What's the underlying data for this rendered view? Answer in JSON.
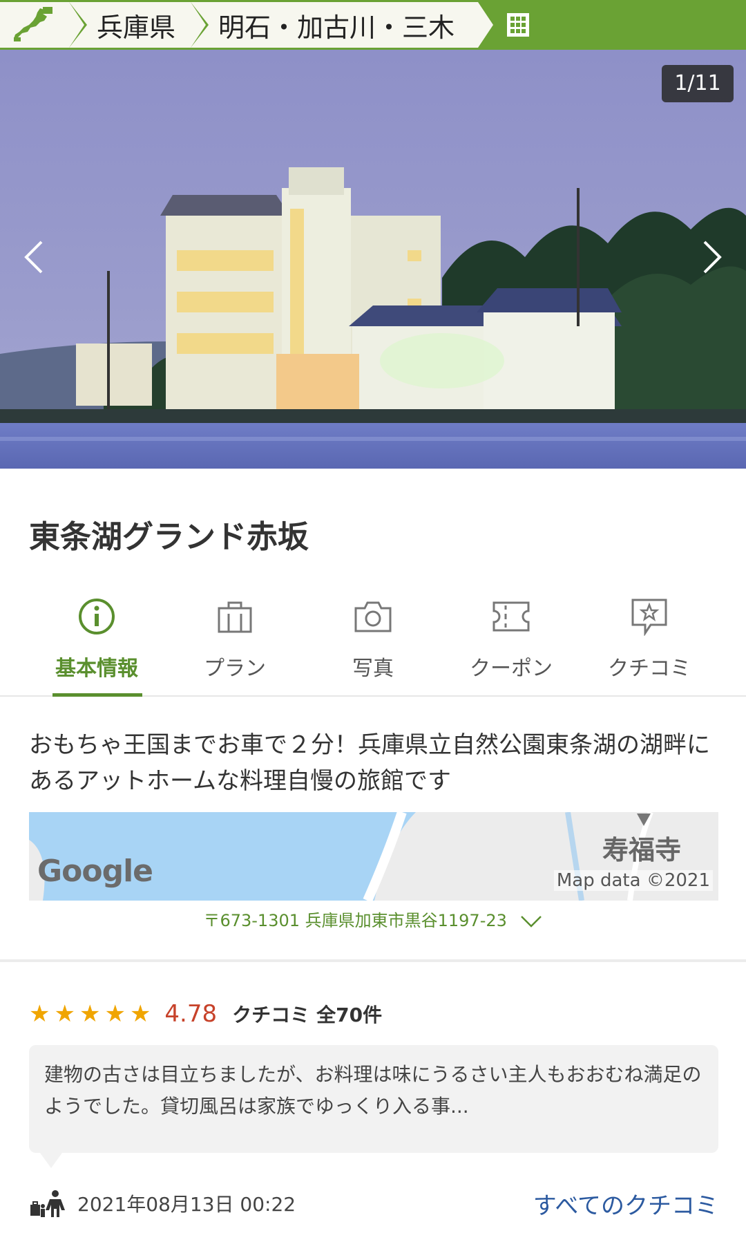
{
  "breadcrumb": {
    "items": [
      "兵庫県",
      "明石・加古川・三木"
    ]
  },
  "photo": {
    "counter": "1/11"
  },
  "hotel": {
    "name": "東条湖グランド赤坂"
  },
  "tabs": [
    {
      "label": "基本情報",
      "icon": "info-icon",
      "active": true
    },
    {
      "label": "プラン",
      "icon": "bag-icon",
      "active": false
    },
    {
      "label": "写真",
      "icon": "camera-icon",
      "active": false
    },
    {
      "label": "クーポン",
      "icon": "ticket-icon",
      "active": false
    },
    {
      "label": "クチコミ",
      "icon": "review-star-icon",
      "active": false
    }
  ],
  "description": "おもちゃ王国までお車で２分！兵庫県立自然公園東条湖の湖畔にあるアットホームな料理自慢の旅館です",
  "map": {
    "place_label": "寿福寺",
    "logo": "Google",
    "attribution": "Map data ©2021"
  },
  "address": "〒673-1301 兵庫県加東市黒谷1197-23",
  "reviews": {
    "stars": 5,
    "score": "4.78",
    "label": "クチコミ",
    "count": "全70件",
    "excerpt": "建物の古さは目立ちましたが、お料理は味にうるさい主人もおおむね満足のようでした。貸切風呂は家族でゆっくり入る事...",
    "date": "2021年08月13日 00:22",
    "all_link": "すべてのクチコミ"
  },
  "colors": {
    "accent_green": "#6aa234",
    "active_tab": "#5a8f2e",
    "score_red": "#c7422a",
    "link_blue": "#2c5aa0",
    "star": "#f0a500"
  }
}
